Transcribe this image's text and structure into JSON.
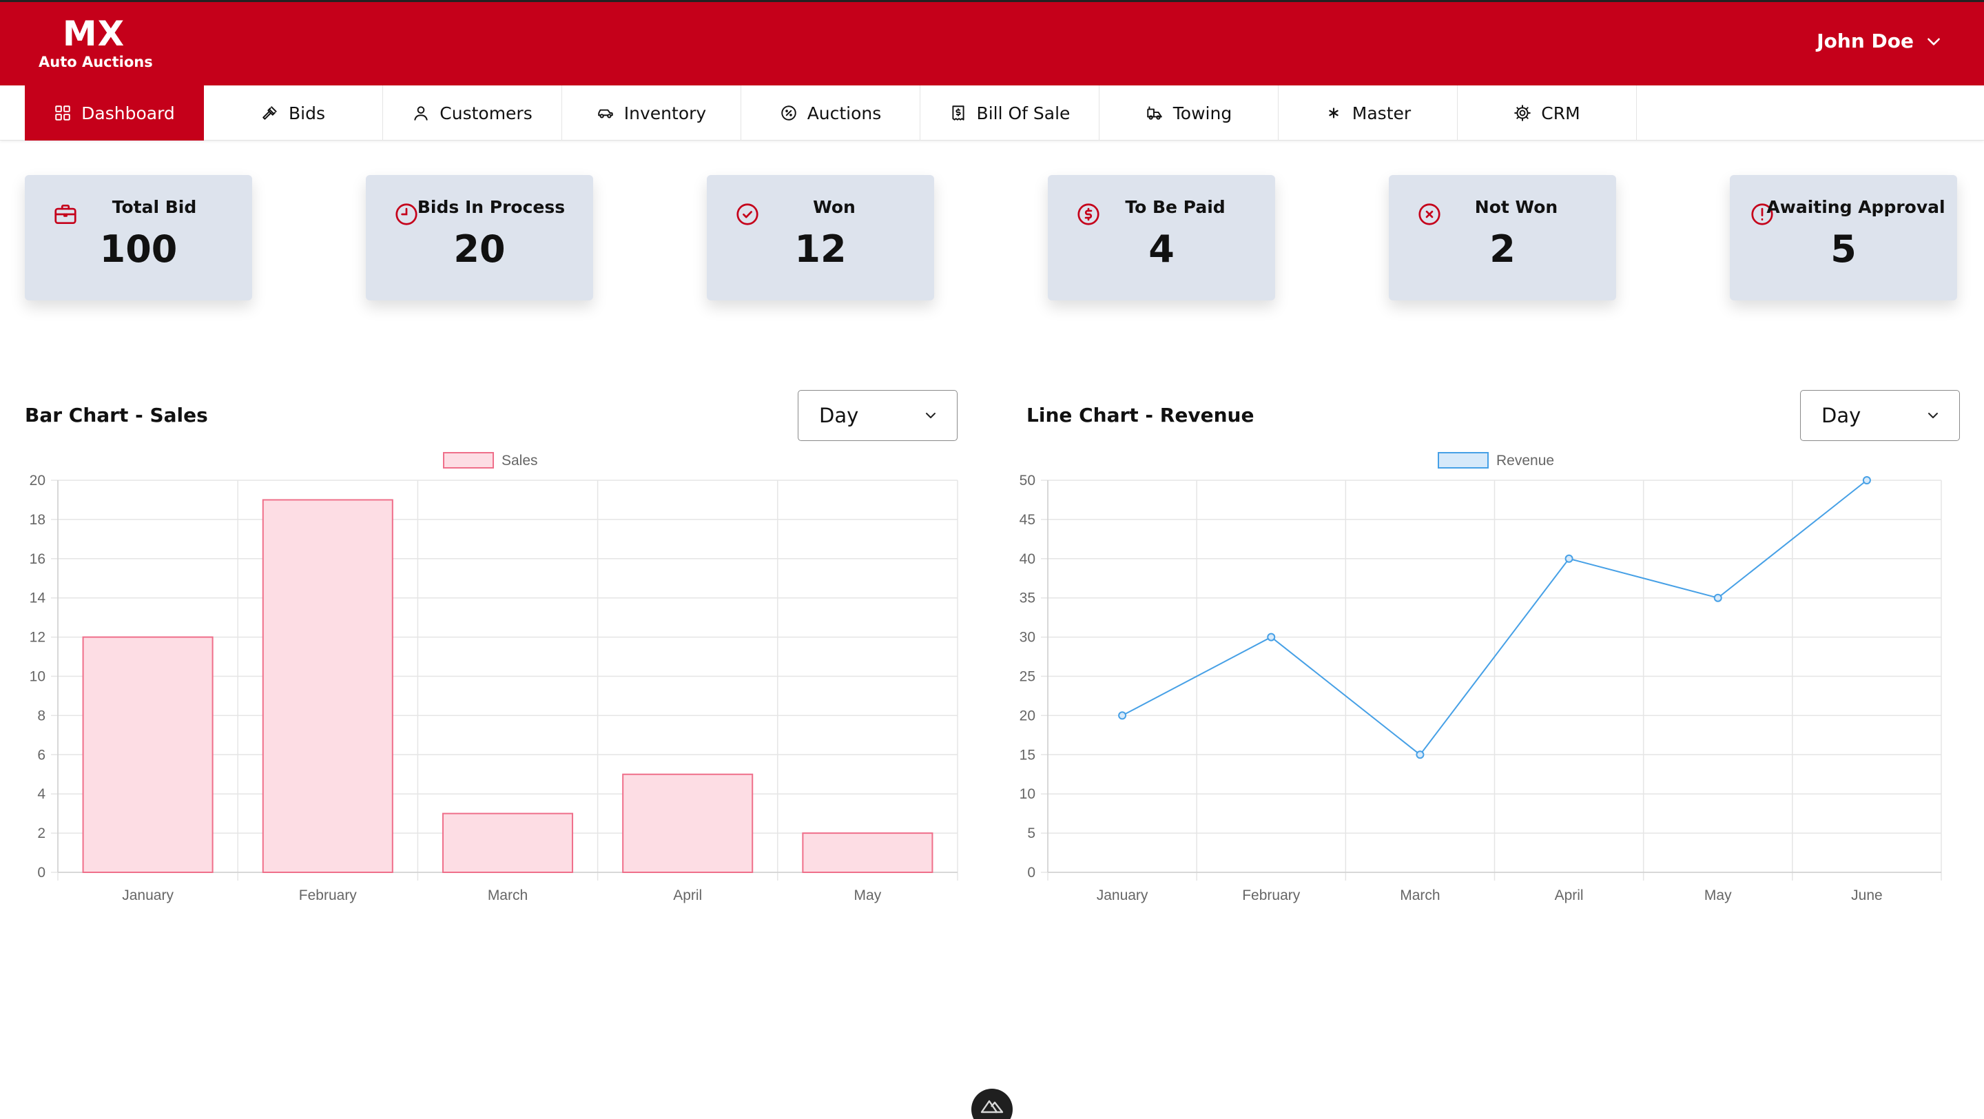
{
  "brand": {
    "name": "MX",
    "subtitle": "Auto Auctions"
  },
  "user": {
    "name": "John Doe"
  },
  "nav": {
    "items": [
      {
        "label": "Dashboard",
        "icon": "dashboard-icon",
        "active": true
      },
      {
        "label": "Bids",
        "icon": "gavel-icon"
      },
      {
        "label": "Customers",
        "icon": "user-icon"
      },
      {
        "label": "Inventory",
        "icon": "car-icon"
      },
      {
        "label": "Auctions",
        "icon": "percent-badge-icon"
      },
      {
        "label": "Bill Of Sale",
        "icon": "receipt-icon"
      },
      {
        "label": "Towing",
        "icon": "tow-truck-icon"
      },
      {
        "label": "Master",
        "icon": "asterisk-icon"
      },
      {
        "label": "CRM",
        "icon": "gear-icon"
      }
    ]
  },
  "stats": [
    {
      "label": "Total Bid",
      "value": "100",
      "icon": "briefcase-icon"
    },
    {
      "label": "Bids In Process",
      "value": "20",
      "icon": "clock-icon"
    },
    {
      "label": "Won",
      "value": "12",
      "icon": "check-circle-icon"
    },
    {
      "label": "To Be Paid",
      "value": "4",
      "icon": "dollar-circle-icon"
    },
    {
      "label": "Not Won",
      "value": "2",
      "icon": "x-circle-icon"
    },
    {
      "label": "Awaiting Approval",
      "value": "5",
      "icon": "alert-circle-icon"
    }
  ],
  "colors": {
    "brand": "#c5001a",
    "card_bg": "#dde3ed",
    "bar_fill": "#fddde4",
    "bar_stroke": "#ef6f8a",
    "line_stroke": "#46a0e6",
    "line_fill": "#d6e9fa"
  },
  "charts": {
    "sales": {
      "title": "Bar Chart - Sales",
      "period": "Day"
    },
    "revenue": {
      "title": "Line Chart - Revenue",
      "period": "Day"
    }
  },
  "chart_data": [
    {
      "type": "bar",
      "title": "Bar Chart - Sales",
      "categories": [
        "January",
        "February",
        "March",
        "April",
        "May"
      ],
      "series": [
        {
          "name": "Sales",
          "values": [
            12,
            19,
            3,
            5,
            2
          ]
        }
      ],
      "ylim": [
        0,
        20
      ],
      "yticks": [
        0,
        2,
        4,
        6,
        8,
        10,
        12,
        14,
        16,
        18,
        20
      ],
      "grid": true,
      "legend": "top-center"
    },
    {
      "type": "line",
      "title": "Line Chart - Revenue",
      "categories": [
        "January",
        "February",
        "March",
        "April",
        "May",
        "June"
      ],
      "series": [
        {
          "name": "Revenue",
          "values": [
            20,
            30,
            15,
            40,
            35,
            50
          ]
        }
      ],
      "ylim": [
        0,
        50
      ],
      "yticks": [
        0,
        5,
        10,
        15,
        20,
        25,
        30,
        35,
        40,
        45,
        50
      ],
      "grid": true,
      "legend": "top-center"
    }
  ]
}
